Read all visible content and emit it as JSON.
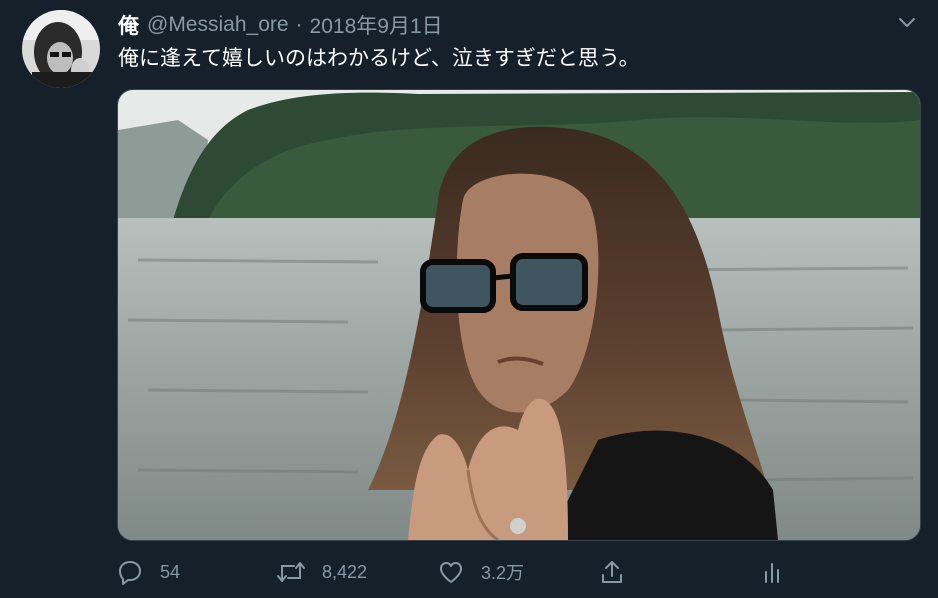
{
  "user": {
    "display_name": "俺",
    "handle": "@Messiah_ore"
  },
  "meta": {
    "separator": "·",
    "date": "2018年9月1日"
  },
  "tweet": {
    "text": "俺に逢えて嬉しいのはわかるけど、泣きすぎだと思う。"
  },
  "stats": {
    "replies": "54",
    "retweets": "8,422",
    "likes": "3.2万"
  },
  "theme": {
    "background": "#15202b",
    "text_primary": "#ffffff",
    "text_secondary": "#8899a6",
    "border": "#38444d"
  },
  "icons": {
    "reply": "reply-icon",
    "retweet": "retweet-icon",
    "like": "heart-icon",
    "share": "share-icon",
    "stats": "analytics-icon",
    "more": "chevron-down-icon"
  }
}
